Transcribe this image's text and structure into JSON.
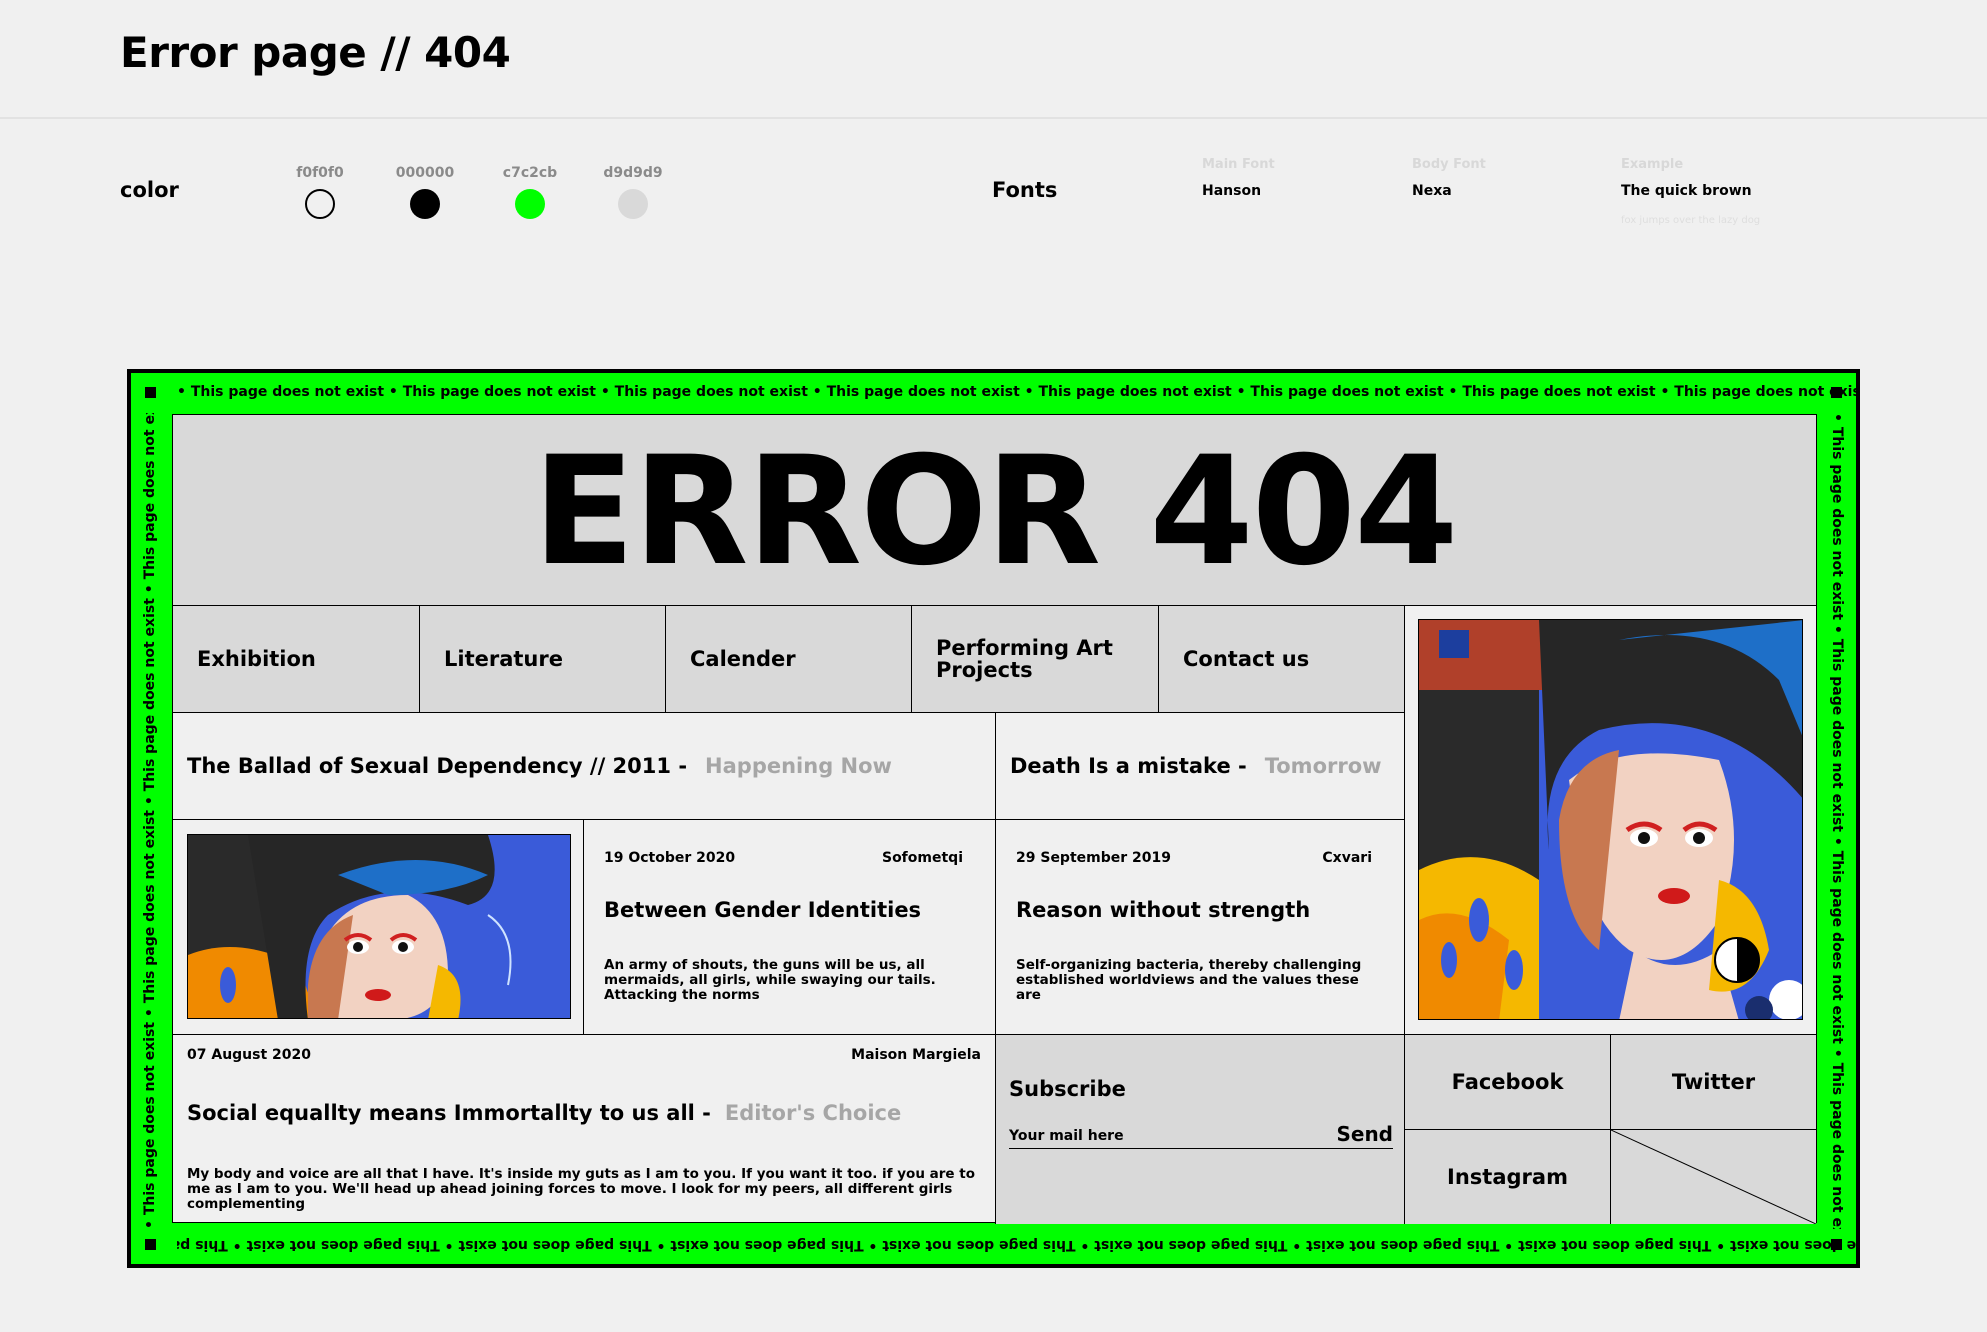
{
  "page": {
    "title": "Error page // 404"
  },
  "style_guide": {
    "color_label": "color",
    "colors": [
      {
        "hex": "f0f0f0"
      },
      {
        "hex": "000000"
      },
      {
        "hex": "c7c2cb"
      },
      {
        "hex": "d9d9d9"
      }
    ],
    "swatch_fills": [
      "#f0f0f0",
      "#000000",
      "#00ff00",
      "#d9d9d9"
    ],
    "fonts_label": "Fonts",
    "fonts": [
      {
        "caption": "Main Font",
        "value": "Hanson"
      },
      {
        "caption": "Body Font",
        "value": "Nexa"
      },
      {
        "caption": "Example",
        "value": "The quick brown",
        "sub": "fox jumps over the lazy dog"
      }
    ]
  },
  "mockup": {
    "ticker_text": "• This page does not exist • This page does not exist • This page does not exist • This page does not exist • This page does not exist • This page does not exist • This page does not exist • This page does not exist • This page does not exist • Th",
    "ticker_text_vertical": "• This page does not exist • This page does not exist • This page does not exist • This page does not exist • This page does not exist • This page does not exis",
    "hero_title": "ERROR 404",
    "nav": [
      "Exhibition",
      "Literature",
      "Calender",
      "Performing Art Projects",
      "Contact us"
    ],
    "events": [
      {
        "title": "The Ballad of Sexual Dependency // 2011 -",
        "status": "Happening Now"
      },
      {
        "title": "Death Is a mistake -",
        "status": "Tomorrow"
      }
    ],
    "articles": [
      {
        "date": "19 October 2020",
        "author": "Sofometqi",
        "title": "Between Gender Identities",
        "text": "An army of shouts, the guns will be us, all mermaids, all girls, while swaying our tails. Attacking the norms"
      },
      {
        "date": "29 September 2019",
        "author": "Cxvari",
        "title": "Reason without strength",
        "text": "Self-organizing bacteria, thereby challenging established worldviews and the values these are"
      }
    ],
    "featured": {
      "date": "07 August 2020",
      "author": "Maison Margiela",
      "title": "Social equallty means Immortallty to us all -",
      "status": "Editor's Choice",
      "text": "My body and voice are all that I have. It's inside my guts as I am to you. If you want it too. if you are to me as I am to you. We'll head up ahead joining forces to move. I look for my peers, all different girls complementing"
    },
    "subscribe": {
      "heading": "Subscribe",
      "placeholder": "Your mail here",
      "send_label": "Send"
    },
    "social": {
      "facebook": "Facebook",
      "twitter": "Twitter",
      "instagram": "Instagram"
    },
    "colors": {
      "frame": "#00ff00",
      "panel": "#d9d9d9",
      "background": "#f0f0f0",
      "muted_status": "#a6a6a6"
    }
  }
}
